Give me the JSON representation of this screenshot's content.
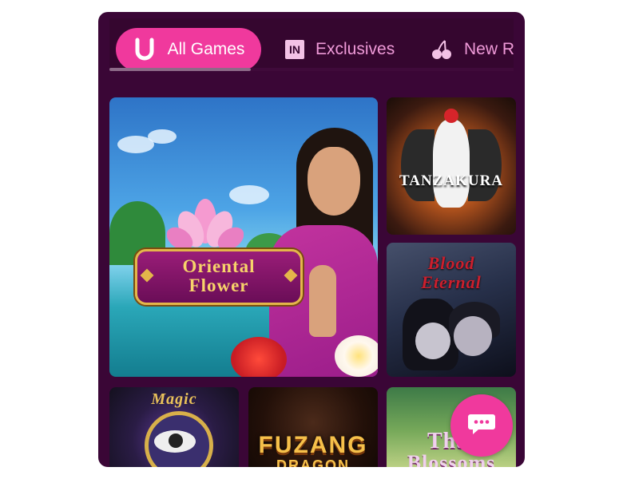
{
  "tabs": [
    {
      "label": "All Games",
      "icon": "horseshoe-icon",
      "active": true
    },
    {
      "label": "Exclusives",
      "icon": "in-badge-icon",
      "active": false
    },
    {
      "label": "New R",
      "icon": "cherries-icon",
      "active": false
    }
  ],
  "tab_badge_text": "IN",
  "tab_scroll_position": 0.35,
  "games": [
    {
      "title_line1": "Oriental",
      "title_line2": "Flower"
    },
    {
      "title": "TANZAKURA"
    },
    {
      "title_line1": "Blood",
      "title_line2": "Eternal"
    },
    {
      "title": "Magic"
    },
    {
      "title": "FUZANG",
      "subtitle": "DRAGON"
    },
    {
      "title": "Thai",
      "subtitle": "Blossoms"
    }
  ],
  "chat_button": {
    "icon": "chat-bubble-icon"
  },
  "colors": {
    "accent": "#f0399d",
    "panel_bg": "#3a0636",
    "tab_inactive_text": "#ef9ad8"
  }
}
